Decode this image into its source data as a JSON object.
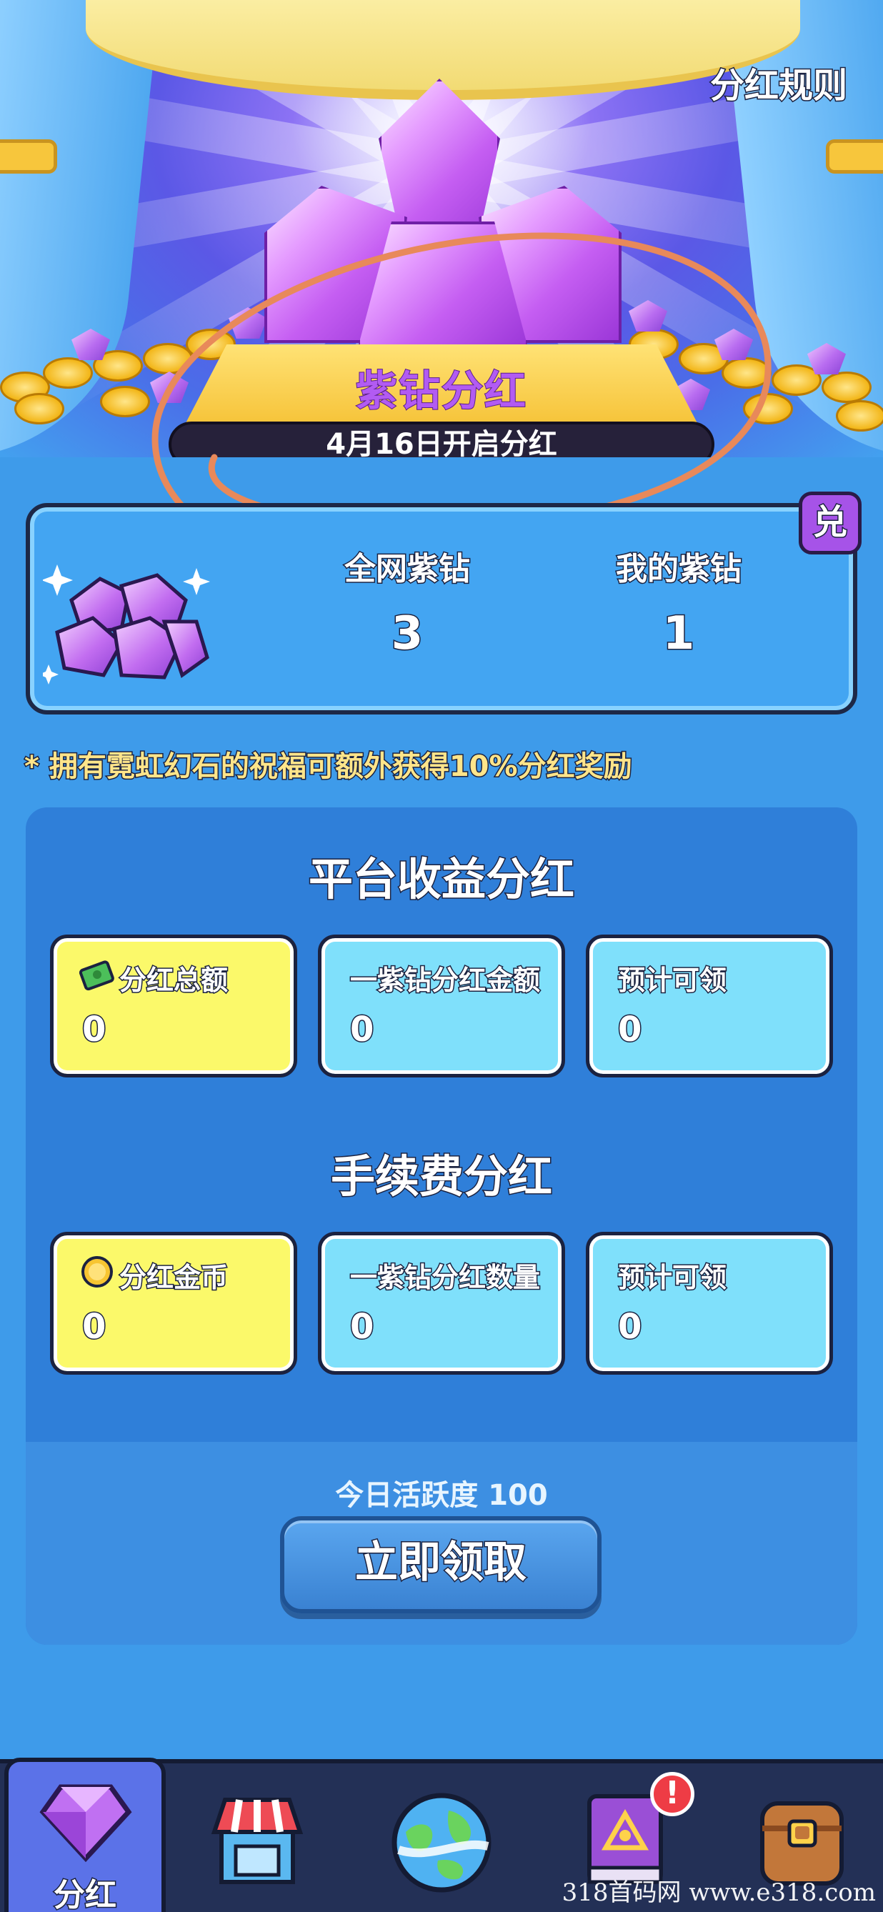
{
  "header": {
    "rules_link": "分红规则",
    "title": "紫钻分红",
    "open_banner": "4月16日开启分红"
  },
  "stats": {
    "exchange_label": "兑",
    "total_label": "全网紫钻",
    "total_value": "3",
    "mine_label": "我的紫钻",
    "mine_value": "1"
  },
  "note": "* 拥有霓虹幻石的祝福可额外获得10%分红奖励",
  "platform_section": {
    "title": "平台收益分红",
    "boxes": [
      {
        "label": "分红总额",
        "value": "0",
        "icon": "cash-icon"
      },
      {
        "label": "一紫钻分红金额",
        "value": "0"
      },
      {
        "label": "预计可领",
        "value": "0"
      }
    ]
  },
  "fee_section": {
    "title": "手续费分红",
    "boxes": [
      {
        "label": "分红金币",
        "value": "0",
        "icon": "gold-coin-icon"
      },
      {
        "label": "一紫钻分红数量",
        "value": "0"
      },
      {
        "label": "预计可领",
        "value": "0"
      }
    ]
  },
  "activity": "今日活跃度 100",
  "claim_button": "立即领取",
  "nav": {
    "items": [
      {
        "label": "分红",
        "icon": "purple-diamond-icon",
        "active": true
      },
      {
        "label": "",
        "icon": "shop-icon"
      },
      {
        "label": "",
        "icon": "globe-icon"
      },
      {
        "label": "",
        "icon": "spellbook-icon",
        "badge": "!"
      },
      {
        "label": "",
        "icon": "backpack-icon"
      }
    ]
  },
  "watermark": "318首码网 www.e318.com",
  "colors": {
    "background": "#3e9bea",
    "panel": "#2f7fd9",
    "yellow_box": "#fbf96a",
    "cyan_box": "#7fe0fb",
    "accent_purple": "#b25bf2",
    "annotation": "#e8895a"
  }
}
